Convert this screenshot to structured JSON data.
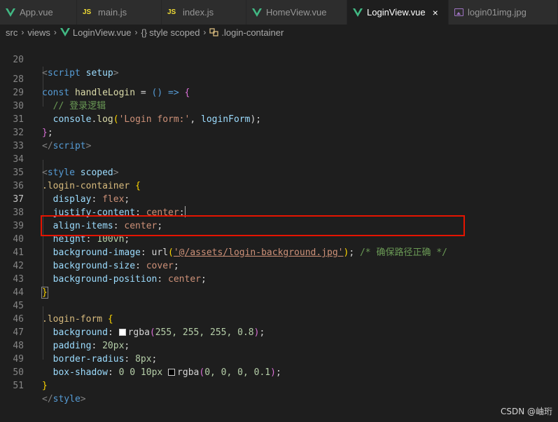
{
  "tabs": [
    {
      "label": "App.vue",
      "icon": "vue-icon"
    },
    {
      "label": "main.js",
      "icon": "js-icon"
    },
    {
      "label": "index.js",
      "icon": "js-icon"
    },
    {
      "label": "HomeView.vue",
      "icon": "vue-icon"
    },
    {
      "label": "LoginView.vue",
      "icon": "vue-icon",
      "active": true,
      "close": "×"
    },
    {
      "label": "login01img.jpg",
      "icon": "image-icon"
    }
  ],
  "js_badge": "JS",
  "breadcrumb": {
    "parts": [
      "src",
      "views",
      "LoginView.vue",
      "style scoped",
      ".login-container"
    ],
    "braces": "{}",
    "separator": "›"
  },
  "editor": {
    "line_numbers": [
      "20",
      "28",
      "29",
      "30",
      "31",
      "32",
      "33",
      "34",
      "35",
      "36",
      "37",
      "38",
      "39",
      "40",
      "41",
      "42",
      "43",
      "44",
      "45",
      "46",
      "47",
      "48",
      "49",
      "50",
      "51"
    ],
    "current_line": "37",
    "lines": {
      "l20": {
        "open": "<",
        "tag": "script",
        "attr": "setup",
        "close": ">"
      },
      "l28": {
        "kw": "const",
        "name": "handleLogin",
        "eq": " = ",
        "arrow": "() => ",
        "brace": "{"
      },
      "l29": {
        "comment": "// 登录逻辑"
      },
      "l30": {
        "obj": "console",
        "dot": ".",
        "fn": "log",
        "open": "(",
        "str": "'Login form:'",
        "comma": ", ",
        "arg": "loginForm",
        "end": ");"
      },
      "l31": {
        "brace": "}",
        "semi": ";"
      },
      "l32": {
        "open": "</",
        "tag": "script",
        "close": ">"
      },
      "l34": {
        "open": "<",
        "tag": "style",
        "attr": "scoped",
        "close": ">"
      },
      "l35": {
        "selector": ".login-container",
        "brace": "{"
      },
      "l36": {
        "prop": "display",
        "value": "flex"
      },
      "l37": {
        "prop": "justify-content",
        "value": "center"
      },
      "l38": {
        "prop": "align-items",
        "value": "center"
      },
      "l39": {
        "prop": "height",
        "num": "100",
        "unit": "vh"
      },
      "l40": {
        "prop": "background-image",
        "fn": "url",
        "open": "(",
        "str": "'@/assets/login-background.jpg'",
        "close": ")",
        "semi": ";",
        "comment": "/* 确保路径正确 */"
      },
      "l41": {
        "prop": "background-size",
        "value": "cover"
      },
      "l42": {
        "prop": "background-position",
        "value": "center"
      },
      "l43": {
        "brace": "}"
      },
      "l45": {
        "selector": ".login-form",
        "brace": "{"
      },
      "l46": {
        "prop": "background",
        "fn": "rgba",
        "args": "255, 255, 255, 0.8",
        "swatch": "#ffffff"
      },
      "l47": {
        "prop": "padding",
        "num": "20",
        "unit": "px"
      },
      "l48": {
        "prop": "border-radius",
        "num": "8",
        "unit": "px"
      },
      "l49": {
        "prop": "box-shadow",
        "pre": "0 0 ",
        "num": "10",
        "unit": "px",
        "fn": "rgba",
        "args": "0, 0, 0, 0.1",
        "swatch": "#000000"
      },
      "l50": {
        "brace": "}"
      },
      "l51": {
        "open": "</",
        "tag": "style",
        "close": ">"
      }
    }
  },
  "colors": {
    "highlight_box": "#e51400",
    "vue_green": "#41b883",
    "js_yellow": "#f1dd35",
    "image_purple": "#a074c4"
  },
  "watermark": "CSDN @岫珩"
}
